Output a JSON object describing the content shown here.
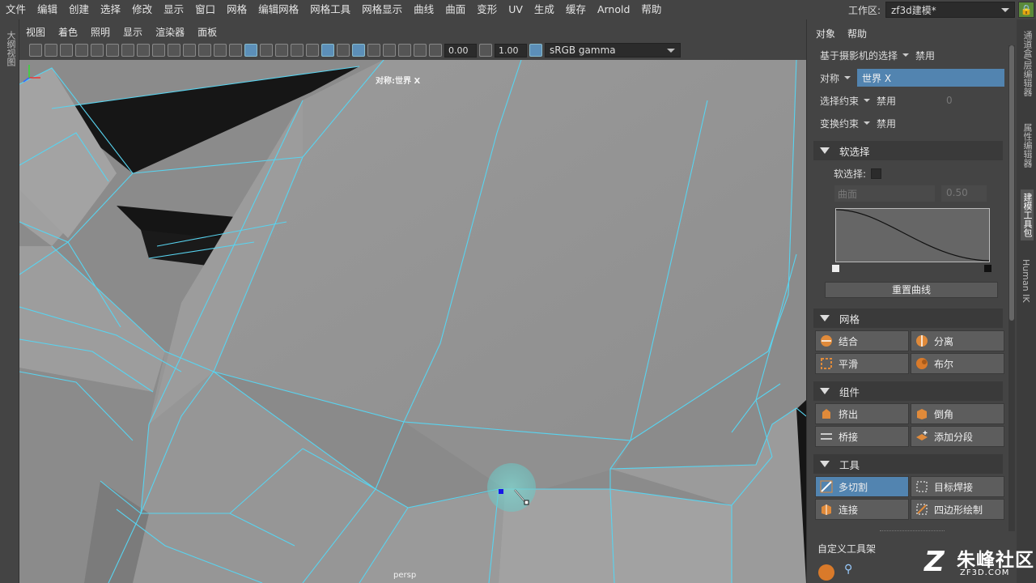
{
  "menubar": {
    "items": [
      "文件",
      "编辑",
      "创建",
      "选择",
      "修改",
      "显示",
      "窗口",
      "网格",
      "编辑网格",
      "网格工具",
      "网格显示",
      "曲线",
      "曲面",
      "变形",
      "UV",
      "生成",
      "缓存",
      "Arnold",
      "帮助"
    ]
  },
  "workspace": {
    "label": "工作区:",
    "value": "zf3d建模*"
  },
  "left_strip": {
    "label": "大纲视图"
  },
  "viewport": {
    "menu": [
      "视图",
      "着色",
      "照明",
      "显示",
      "渲染器",
      "面板"
    ],
    "toolbar": {
      "exposure": "0.00",
      "gamma": "1.00",
      "colorspace": "sRGB gamma"
    },
    "symmetry_label": "对称:世界 X",
    "camera_label": "persp",
    "wire_color": "#58d4f0"
  },
  "right_panel": {
    "menu": [
      "对象",
      "帮助"
    ],
    "camera_select": {
      "label": "基于摄影机的选择",
      "value": "禁用"
    },
    "symmetry": {
      "label": "对称",
      "value": "世界 X"
    },
    "select_constraint": {
      "label": "选择约束",
      "value": "禁用",
      "number": "0"
    },
    "transform_constraint": {
      "label": "变换约束",
      "value": "禁用"
    },
    "soft_select": {
      "header": "软选择",
      "toggle_label": "软选择:",
      "falloff_mode": "曲面",
      "falloff_radius": "0.50",
      "reset_label": "重置曲线"
    },
    "sections": [
      {
        "header": "网格",
        "buttons": [
          {
            "label": "结合",
            "icon": "combine-icon"
          },
          {
            "label": "分离",
            "icon": "separate-icon"
          },
          {
            "label": "平滑",
            "icon": "smooth-icon"
          },
          {
            "label": "布尔",
            "icon": "boolean-icon"
          }
        ]
      },
      {
        "header": "组件",
        "buttons": [
          {
            "label": "挤出",
            "icon": "extrude-icon"
          },
          {
            "label": "倒角",
            "icon": "bevel-icon"
          },
          {
            "label": "桥接",
            "icon": "bridge-icon"
          },
          {
            "label": "添加分段",
            "icon": "add-divisions-icon"
          }
        ]
      },
      {
        "header": "工具",
        "buttons": [
          {
            "label": "多切割",
            "icon": "multi-cut-icon",
            "active": true
          },
          {
            "label": "目标焊接",
            "icon": "target-weld-icon"
          },
          {
            "label": "连接",
            "icon": "connect-icon"
          },
          {
            "label": "四边形绘制",
            "icon": "quad-draw-icon"
          }
        ]
      }
    ],
    "custom_shelf": "自定义工具架"
  },
  "right_tabs": [
    "通道盒/层编辑器",
    "属性编辑器",
    "建模工具包",
    "Human IK"
  ],
  "watermark": {
    "cn": "朱峰社区",
    "en": "ZF3D.COM",
    "mark": "Z"
  }
}
